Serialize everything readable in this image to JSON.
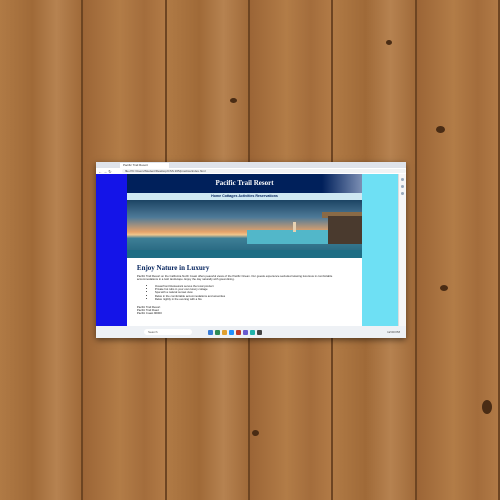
{
  "browser": {
    "tab_title": "Pacific Trail Resort",
    "url": "file:///C:/Users/Student/Desktop/CSS 205/practice/index.html"
  },
  "site": {
    "header_title": "Pacific Trail Resort",
    "nav": "Home  Cottages  Activities  Reservations",
    "heading": "Enjoy Nature in Luxury",
    "intro": "Pacific Trail Resort on the California North Coast offers peaceful views of the Pacific Ocean. Our guests experience secluded relaxing luxurious in comfortable accommodations in a lush landscape. Enjoy the day naturally with great dining.",
    "features": [
      "Oceanfront Restaurant serves the local product",
      "Private hot tubs in your own luxury cottage",
      "Spa with a natural sunset view",
      "Relax in the comfortable accommodations and amenities",
      "Relax nightly in the evening with a fire"
    ],
    "address": [
      "Pacific Trail Resort",
      "Pacific Trail Road",
      "Pacific Coast 90000"
    ]
  },
  "taskbar": {
    "search_placeholder": "Search",
    "clock": "12:00 PM"
  },
  "colors": {
    "wood": "#a8713e",
    "left_panel": "#1414e8",
    "right_panel": "#6ee0f4",
    "header_bg": "#00205b"
  }
}
